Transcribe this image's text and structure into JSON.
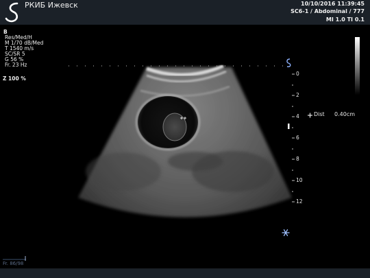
{
  "header": {
    "institution": "РКИБ Ижевск",
    "datetime": "10/10/2016 11:39:45",
    "preset": "SC6-1 / Abdominal / 777",
    "indices": "MI 1.0  TI 0.1",
    "logo_icon": "s-wave-logo-icon",
    "background": "#1b2128"
  },
  "params": {
    "mode": "B",
    "resolution": "Res/Med/H",
    "map": "M 1/70 dB/Med",
    "speed": "T 1540 m/s",
    "sc_sr": "SC/SR 5",
    "gain": "G 56 %",
    "frame_rate": "Fr. 23 Hz",
    "zoom": "Z  100  %"
  },
  "depth_scale": {
    "labels": [
      "0",
      "2",
      "4",
      "6",
      "8",
      "10",
      "12"
    ],
    "unit": "cm",
    "focus_marker_icon": "focus-marker-icon",
    "probe_orientation_icon": "probe-orientation-icon"
  },
  "measurement": {
    "icon": "caliper-cross-icon",
    "label": "Dist",
    "value": "0.40cm",
    "color": "#e8e8e8"
  },
  "status": {
    "freeze_icon": "snowflake-freeze-icon",
    "freeze_color": "#9fc0ff",
    "frame_counter": "Fr. 86/98"
  },
  "grayscale_bar": {
    "icon": "grayscale-bar-icon"
  }
}
